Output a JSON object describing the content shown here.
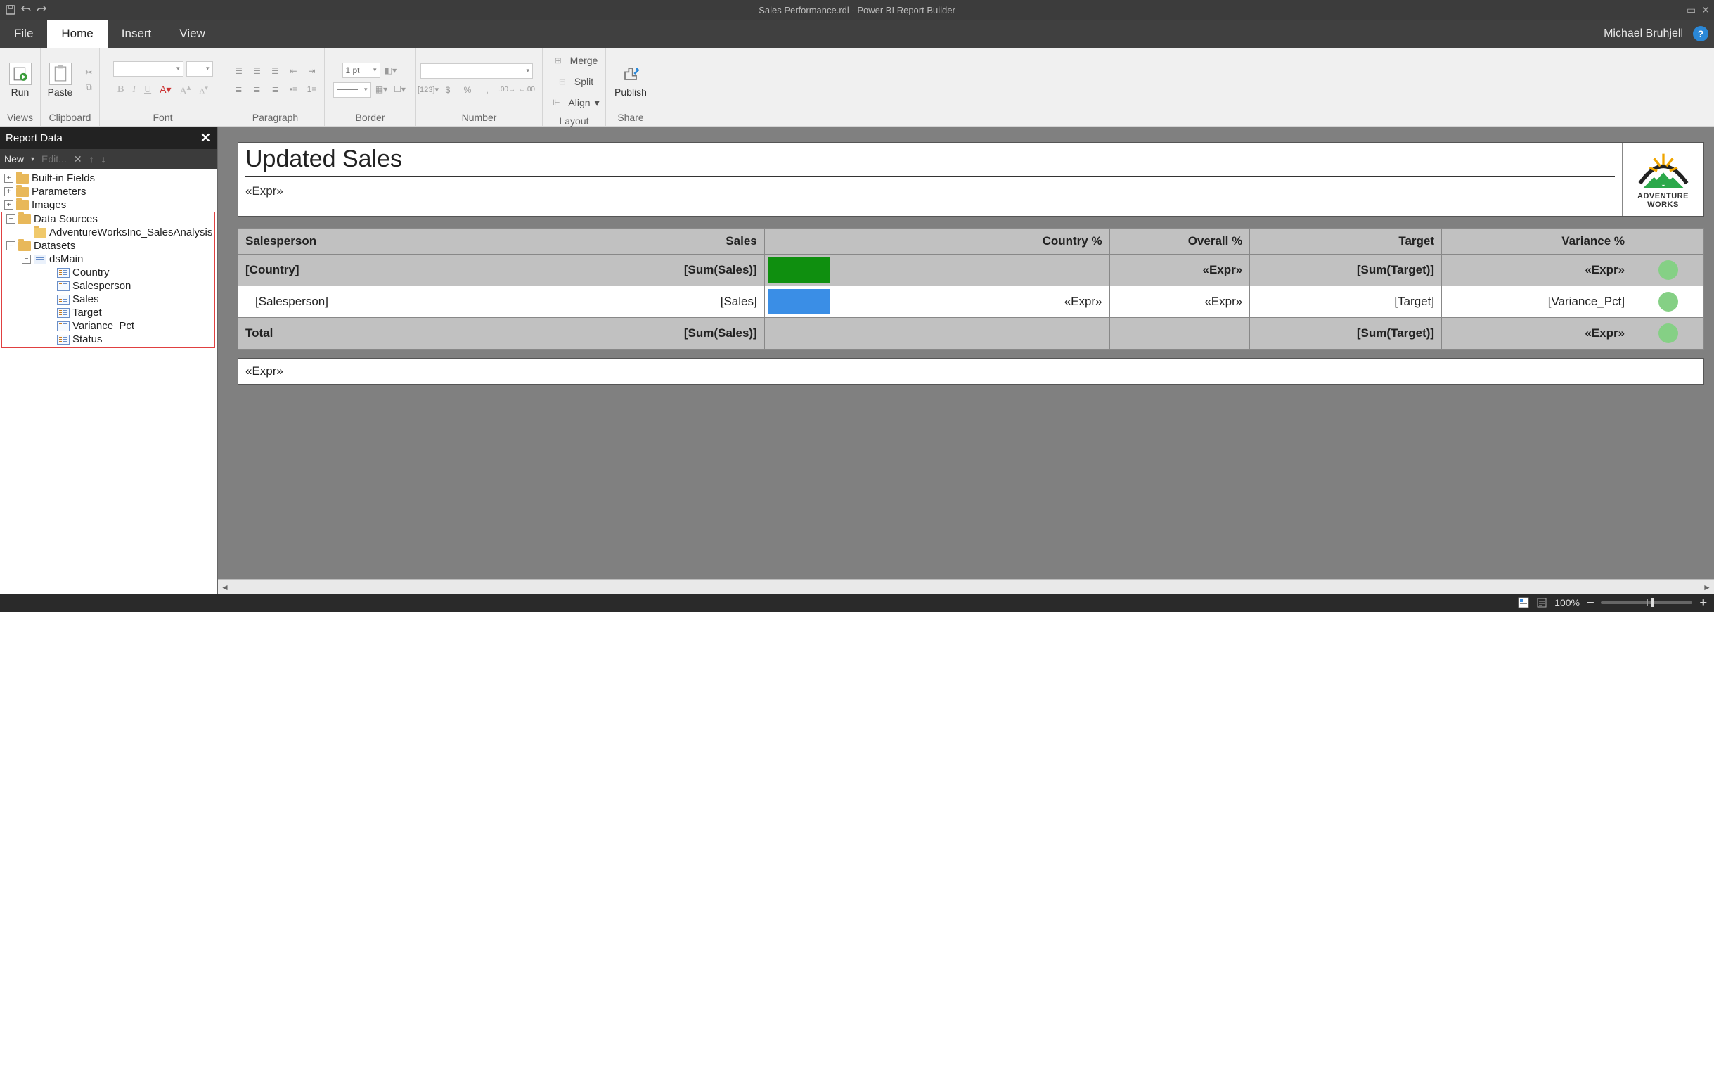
{
  "titlebar": {
    "window_title": "Sales Performance.rdl - Power BI Report Builder"
  },
  "menubar": {
    "items": [
      "File",
      "Home",
      "Insert",
      "View"
    ],
    "active_index": 1,
    "user": "Michael Bruhjell"
  },
  "ribbon": {
    "run": "Run",
    "paste": "Paste",
    "publish": "Publish",
    "border_width": "1 pt",
    "layout": {
      "merge": "Merge",
      "split": "Split",
      "align": "Align"
    },
    "groups": [
      "Views",
      "Clipboard",
      "Font",
      "Paragraph",
      "Border",
      "Number",
      "Layout",
      "Share"
    ]
  },
  "panel": {
    "title": "Report Data",
    "toolbar": {
      "new": "New",
      "edit": "Edit..."
    },
    "builtin": "Built-in Fields",
    "parameters": "Parameters",
    "images": "Images",
    "data_sources": "Data Sources",
    "datasource1": "AdventureWorksInc_SalesAnalysis",
    "datasets": "Datasets",
    "dataset1": "dsMain",
    "fields": [
      "Country",
      "Salesperson",
      "Sales",
      "Target",
      "Variance_Pct",
      "Status"
    ]
  },
  "report": {
    "title": "Updated Sales",
    "header_expr": "«Expr»",
    "footer_expr": "«Expr»",
    "logo_text_top": "ADVENTURE",
    "logo_text_bottom": "WORKS",
    "columns": [
      "Salesperson",
      "Sales",
      "",
      "Country %",
      "Overall %",
      "Target",
      "Variance %",
      ""
    ],
    "group_row": {
      "c0": "[Country]",
      "c1": "[Sum(Sales)]",
      "c4": "«Expr»",
      "c5": "[Sum(Target)]",
      "c6": "«Expr»"
    },
    "detail_row": {
      "c0": "[Salesperson]",
      "c1": "[Sales]",
      "c3": "«Expr»",
      "c4": "«Expr»",
      "c5": "[Target]",
      "c6": "[Variance_Pct]"
    },
    "total_row": {
      "c0": "Total",
      "c1": "[Sum(Sales)]",
      "c5": "[Sum(Target)]",
      "c6": "«Expr»"
    }
  },
  "statusbar": {
    "zoom": "100%"
  }
}
